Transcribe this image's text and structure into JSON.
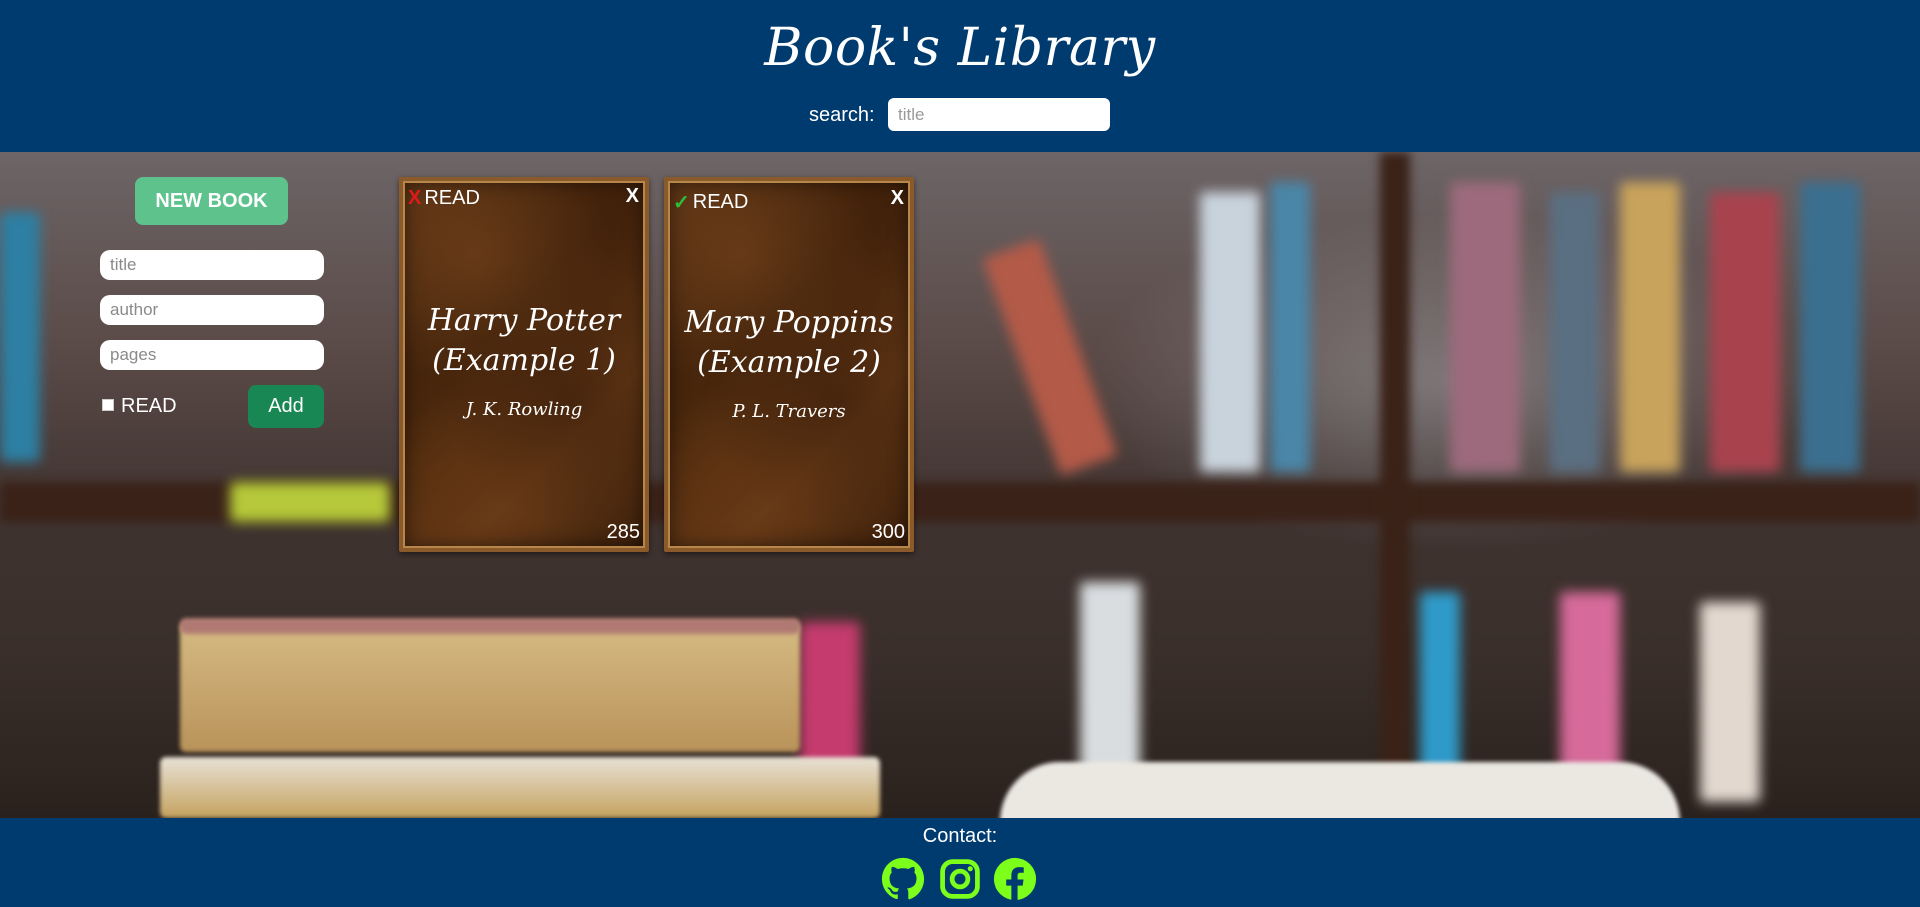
{
  "header": {
    "title": "Book's Library",
    "search_label": "search:",
    "search_placeholder": "title"
  },
  "sidebar": {
    "new_book_label": "NEW BOOK",
    "title_placeholder": "title",
    "author_placeholder": "author",
    "pages_placeholder": "pages",
    "read_label": "READ",
    "add_label": "Add"
  },
  "books": [
    {
      "status_icon": "X",
      "read_label": "READ",
      "close": "X",
      "title_line1": "Harry Potter",
      "title_line2": "(Example 1)",
      "author": "J. K. Rowling",
      "pages": "285",
      "read": false
    },
    {
      "status_icon": "✓",
      "read_label": "READ",
      "close": "X",
      "title_line1": "Mary Poppins",
      "title_line2": "(Example 2)",
      "author": "P. L. Travers",
      "pages": "300",
      "read": true
    }
  ],
  "footer": {
    "contact_label": "Contact:",
    "icons": [
      "github-icon",
      "instagram-icon",
      "facebook-icon"
    ],
    "icon_color": "#7cff1a"
  },
  "colors": {
    "header_bg": "#003b6f",
    "new_book_bg": "#5ec28d",
    "add_bg": "#198754"
  }
}
